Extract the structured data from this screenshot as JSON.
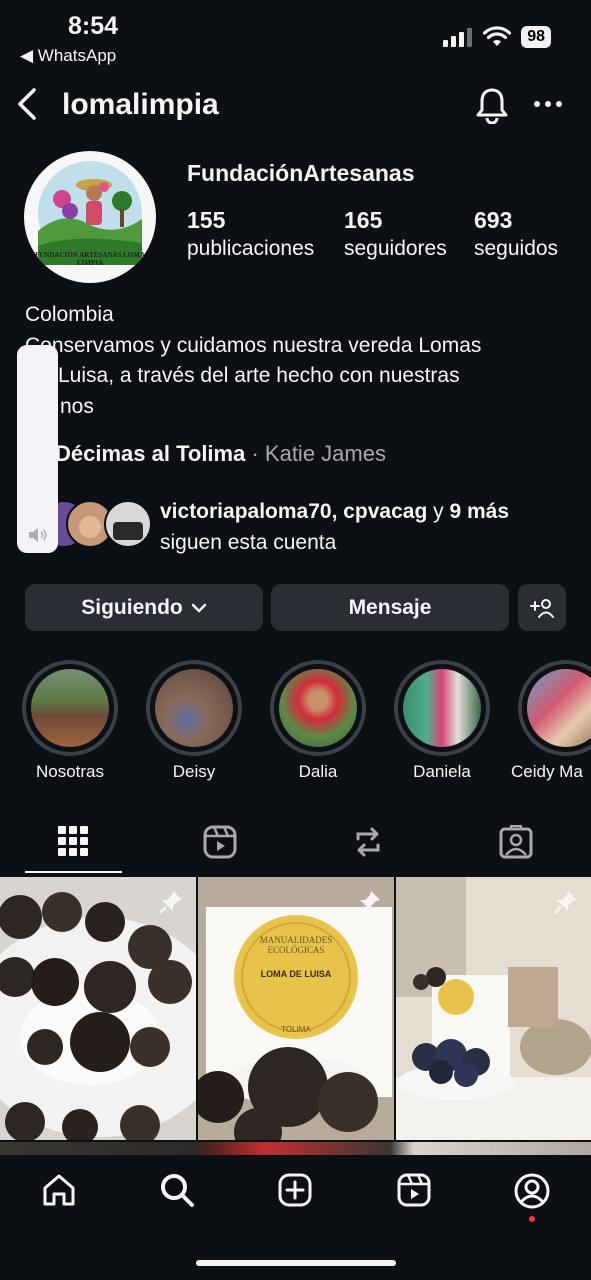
{
  "status_bar": {
    "time": "8:54",
    "back_app": "◀ WhatsApp",
    "battery": "98"
  },
  "header": {
    "username": "lomalimpia"
  },
  "profile": {
    "display_name": "FundaciónArtesanas",
    "avatar_text": "FUNDACIÓN ARTESANAS LOMA LIMPIA",
    "stats": [
      {
        "value": "155",
        "label": "publicaciones"
      },
      {
        "value": "165",
        "label": "seguidores"
      },
      {
        "value": "693",
        "label": "seguidos"
      }
    ],
    "bio_lines": [
      "Colombia",
      "Conservamos y cuidamos nuestra vereda Lomas",
      "Luisa, a través del arte hecho con nuestras",
      "nos"
    ],
    "music": {
      "song": "Décimas al Tolima",
      "separator": " · ",
      "artist": "Katie James"
    },
    "followed_by": {
      "names": "victoriapaloma70, cpvacag",
      "connector": " y ",
      "more": "9 más",
      "suffix": "siguen esta cuenta"
    }
  },
  "actions": {
    "following": "Siguiendo",
    "message": "Mensaje"
  },
  "highlights": [
    {
      "label": "Nosotras"
    },
    {
      "label": "Deisy"
    },
    {
      "label": "Dalia"
    },
    {
      "label": "Daniela"
    },
    {
      "label": "Ceidy Ma"
    }
  ],
  "post_texts": {
    "label_title": "MANUALIDADES ECOLÓGICAS",
    "label_sub": "LOMA DE LUISA",
    "label_place": "TOLIMA"
  },
  "colors": {
    "background": "#0c0f14",
    "button": "#2a2d33",
    "notification_dot": "#ff3040",
    "muted": "#a8a8ad"
  }
}
